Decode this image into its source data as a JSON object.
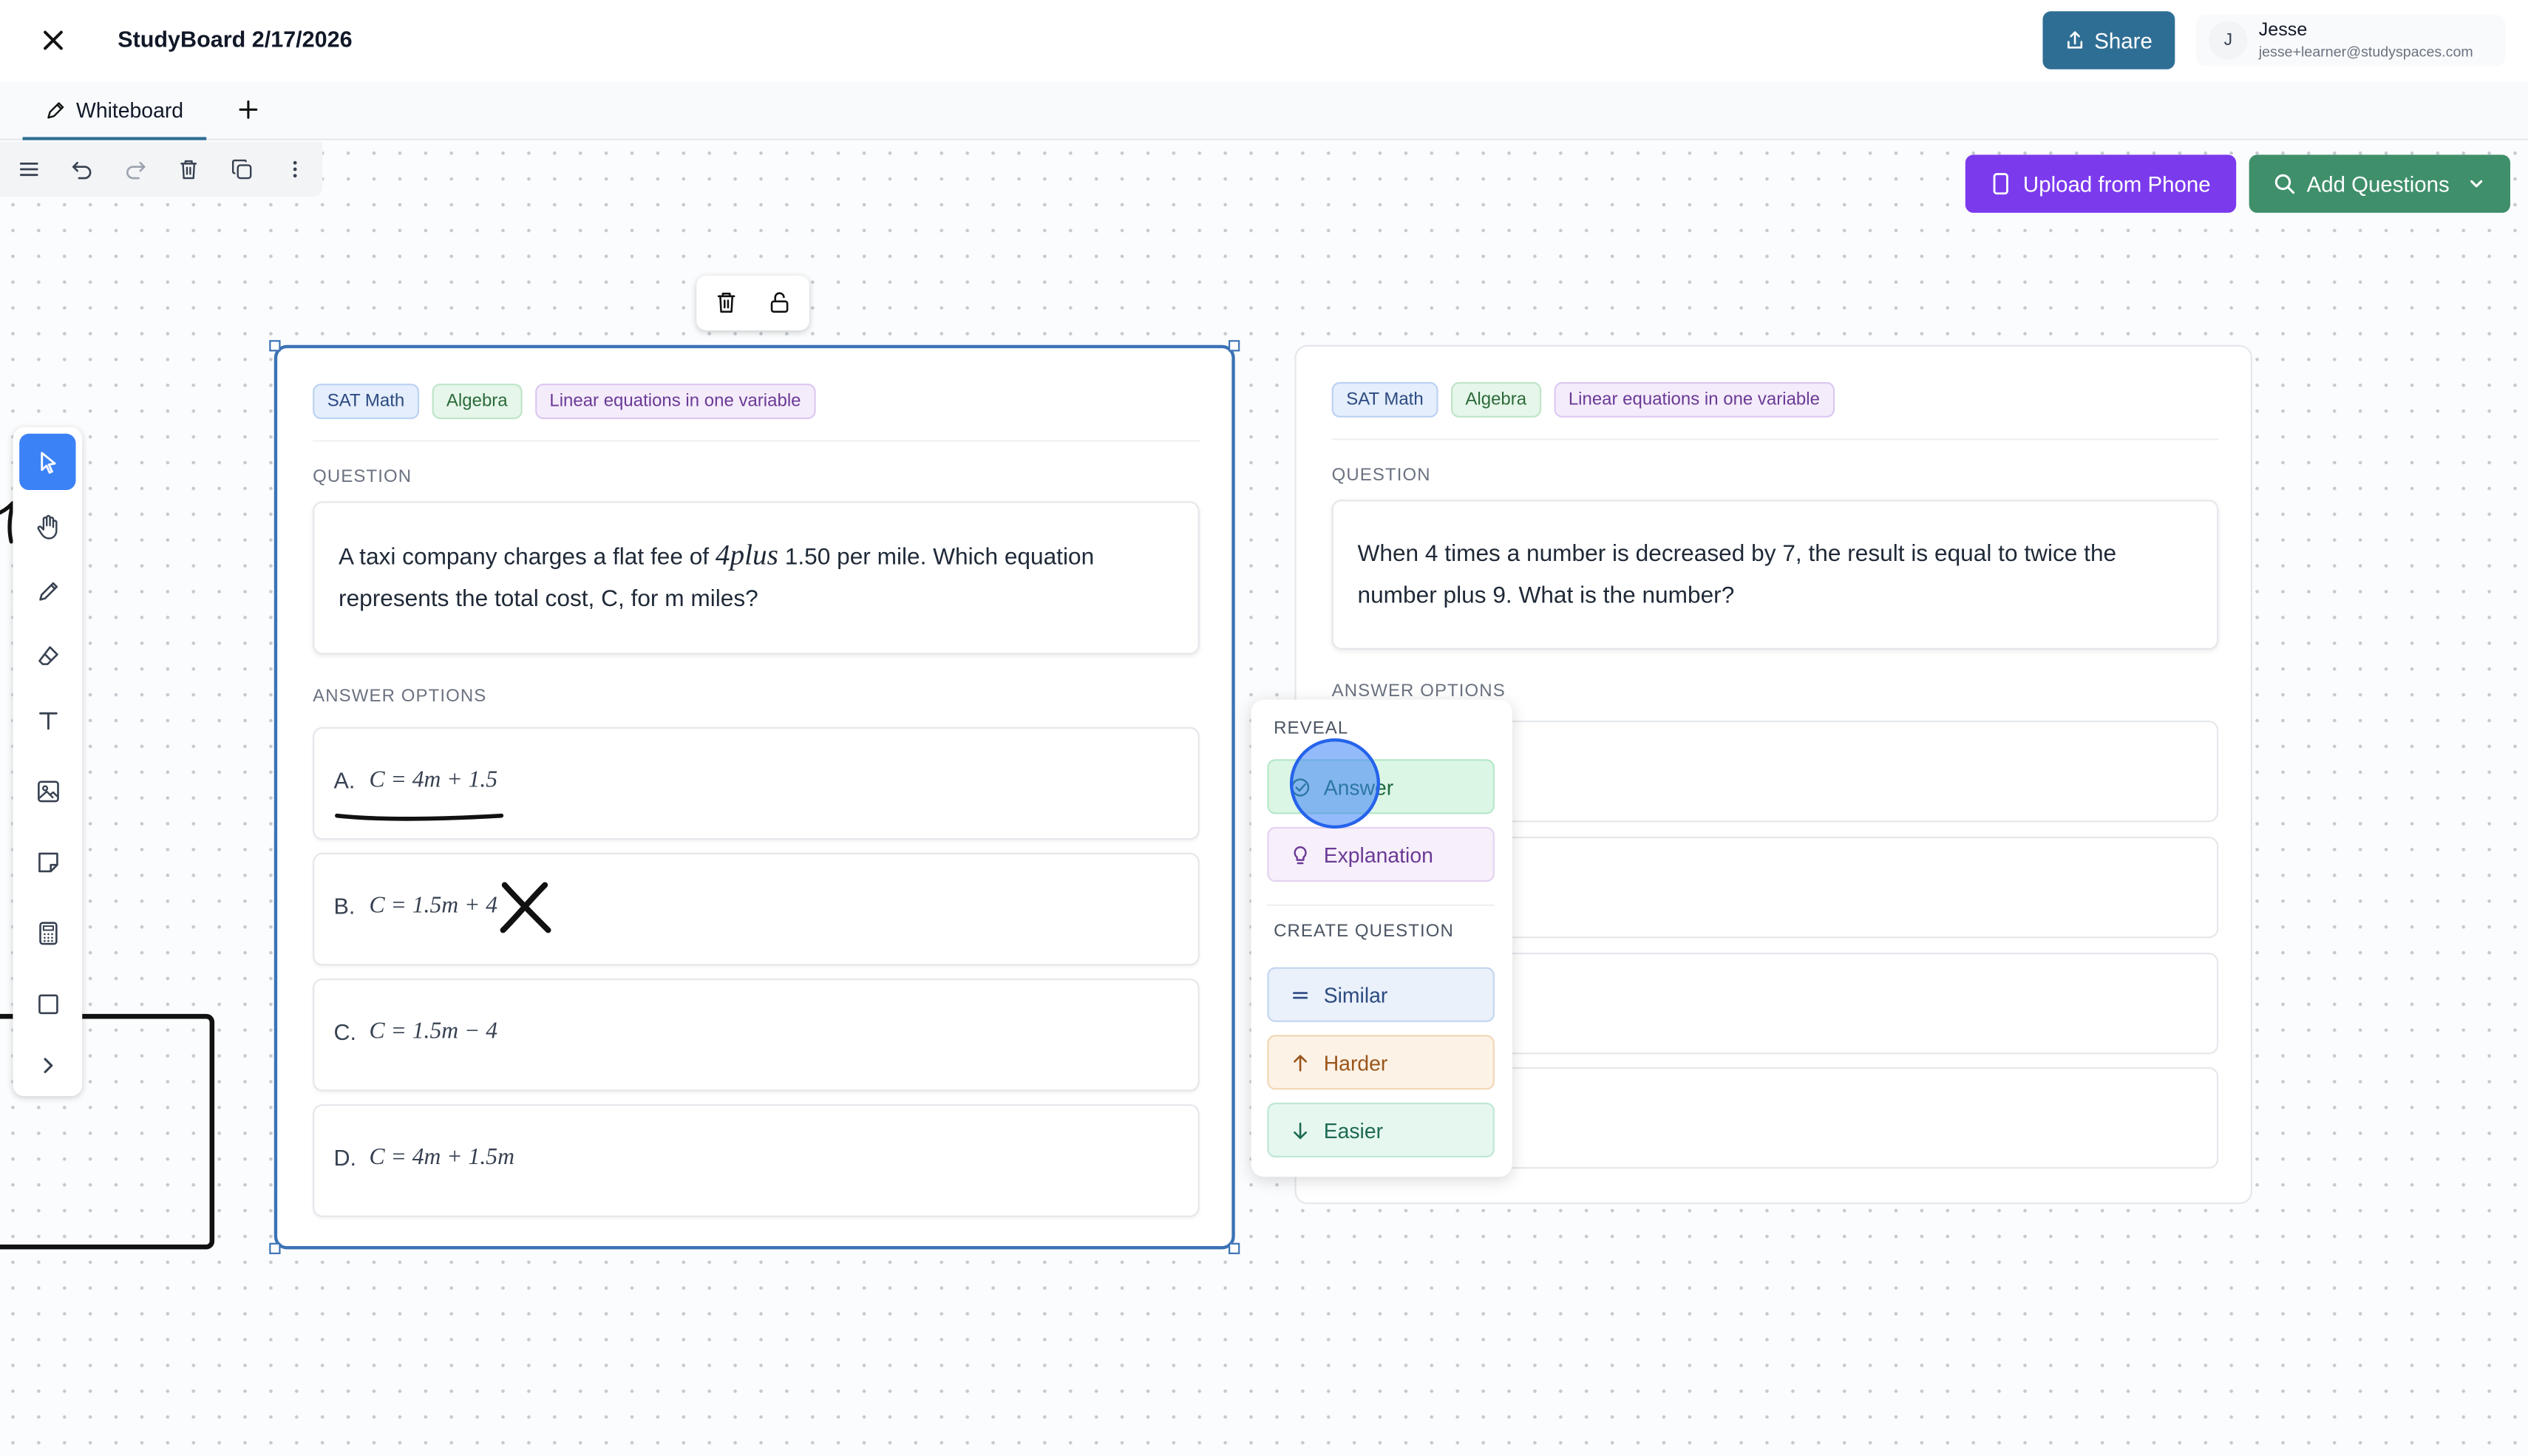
{
  "header": {
    "title": "StudyBoard 2/17/2026",
    "share_label": "Share",
    "user": {
      "initial": "J",
      "name": "Jesse",
      "email": "jesse+learner@studyspaces.com"
    }
  },
  "tabs": [
    {
      "label": "Whiteboard"
    }
  ],
  "toolbar": {
    "upload_label": "Upload from Phone",
    "add_questions_label": "Add Questions"
  },
  "tools": [
    "select-pointer",
    "hand-pan",
    "pencil",
    "eraser",
    "text",
    "image",
    "sticky-note",
    "calculator",
    "rectangle",
    "expand-chevron"
  ],
  "card1": {
    "tags": [
      "SAT Math",
      "Algebra",
      "Linear equations in one variable"
    ],
    "question_label": "QUESTION",
    "question_before": "A taxi company charges a flat fee of",
    "question_math": "4plus",
    "question_after": "1.50 per mile. Which equation represents the total cost, C, for m miles?",
    "answers_label": "ANSWER OPTIONS",
    "options": [
      {
        "letter": "A.",
        "expr": "C = 4m + 1.5"
      },
      {
        "letter": "B.",
        "expr": "C = 1.5m + 4"
      },
      {
        "letter": "C.",
        "expr": "C = 1.5m − 4"
      },
      {
        "letter": "D.",
        "expr": "C = 4m + 1.5m"
      }
    ]
  },
  "card2": {
    "tags": [
      "SAT Math",
      "Algebra",
      "Linear equations in one variable"
    ],
    "question_label": "QUESTION",
    "question": "When 4 times a number is decreased by 7, the result is equal to twice the number plus 9. What is the number?",
    "answers_label": "ANSWER OPTIONS"
  },
  "popover": {
    "reveal_label": "REVEAL",
    "answer_label": "Answer",
    "explanation_label": "Explanation",
    "create_label": "CREATE QUESTION",
    "similar_label": "Similar",
    "harder_label": "Harder",
    "easier_label": "Easier"
  },
  "colors": {
    "share": "#2f6e94",
    "upload": "#7c3aed",
    "add_questions": "#3f8f6b",
    "selection": "#3a72b5",
    "active_tool": "#3b82f6"
  }
}
